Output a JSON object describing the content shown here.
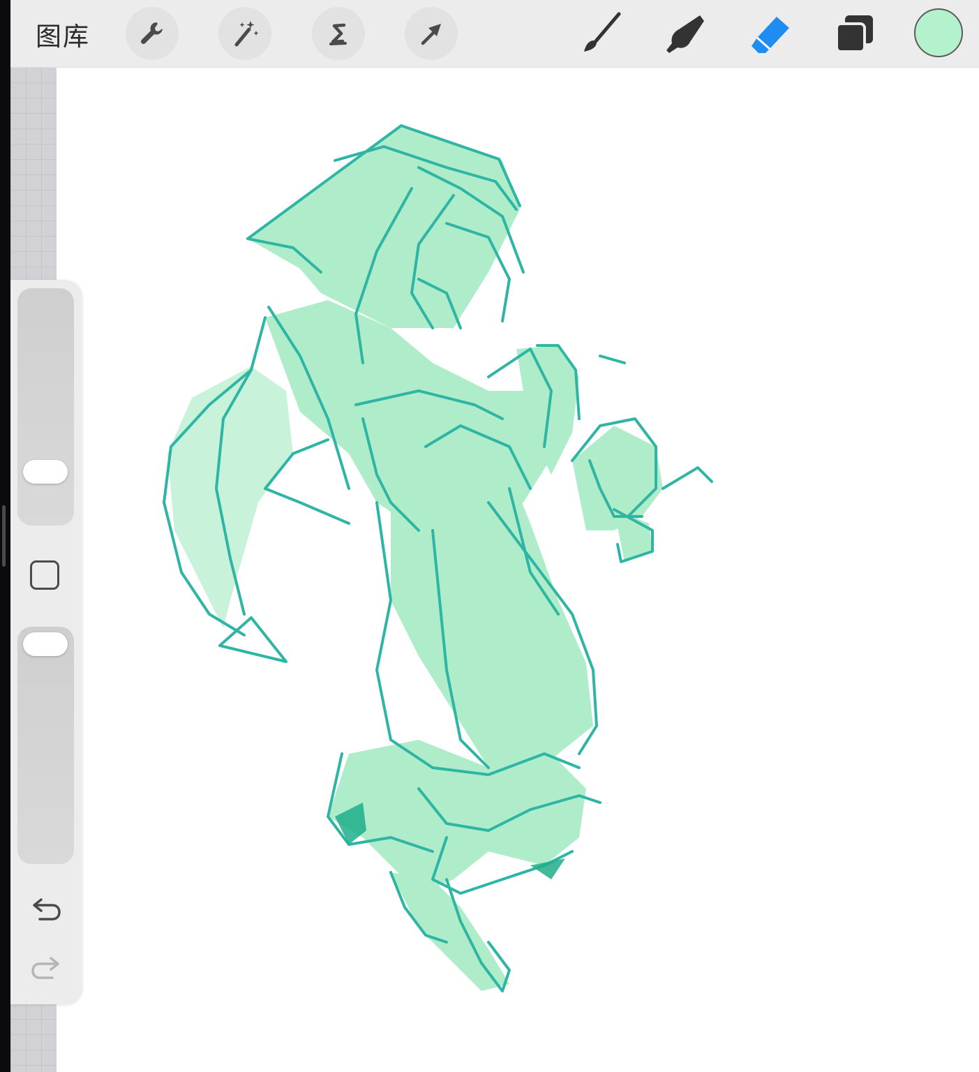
{
  "toolbar": {
    "gallery_label": "图库",
    "actions_icon": "wrench-icon",
    "adjustments_icon": "magic-wand-icon",
    "selection_icon": "selection-s-icon",
    "transform_icon": "arrow-cursor-icon",
    "paint_icon": "brush-icon",
    "smudge_icon": "smudge-finger-icon",
    "erase_icon": "eraser-icon",
    "layers_icon": "layers-icon",
    "active_tool": "erase",
    "active_tool_color": "#1e8cf0",
    "current_color": "#b3f2cc"
  },
  "sidebar": {
    "brush_size_level": 0.77,
    "opacity_level": 0.03,
    "modify_icon": "square-modify-icon",
    "undo_icon": "undo-arrow-icon",
    "redo_icon": "redo-arrow-icon",
    "redo_enabled": false
  },
  "canvas": {
    "background": "#ffffff",
    "fill_color": "#a6ebc4",
    "line_color": "#2fb5a3"
  }
}
